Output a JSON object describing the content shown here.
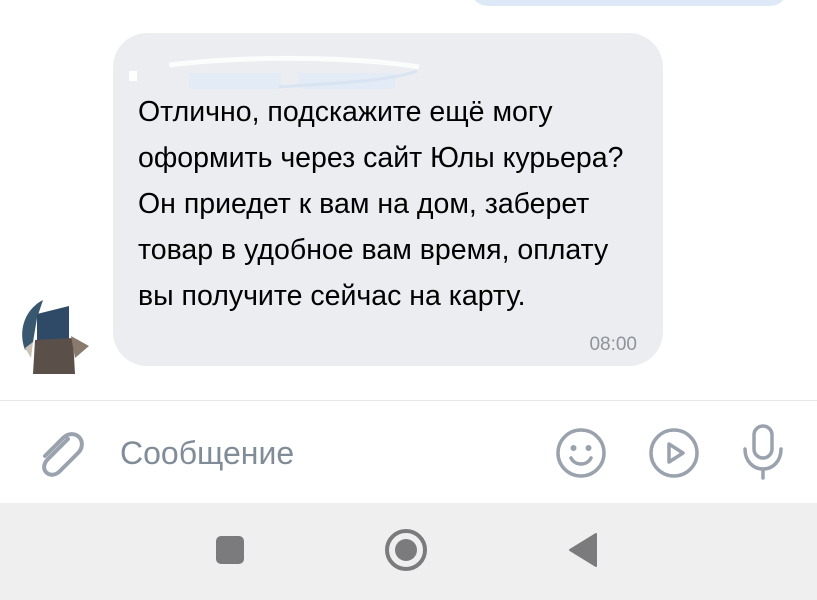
{
  "message": {
    "text": "Отлично, подскажите ещё могу оформить через сайт Юлы курьера? Он приедет к вам на дом, заберет товар в удобное вам время, оплату вы получите сейчас на карту.",
    "time": "08:00"
  },
  "composer": {
    "placeholder": "Сообщение",
    "icons": [
      "paperclip-icon",
      "smile-icon",
      "play-circle-icon",
      "microphone-icon"
    ]
  },
  "navigation": {
    "buttons": [
      "recents-square-icon",
      "home-circle-icon",
      "back-triangle-icon"
    ]
  },
  "colors": {
    "bubble": "#ebedf0",
    "outgoing_bubble": "#dde9f6",
    "icon": "#99a2ad",
    "timestamp": "#8e949b",
    "navbar": "#efeff0",
    "nav_icon": "#7b7b7e"
  }
}
